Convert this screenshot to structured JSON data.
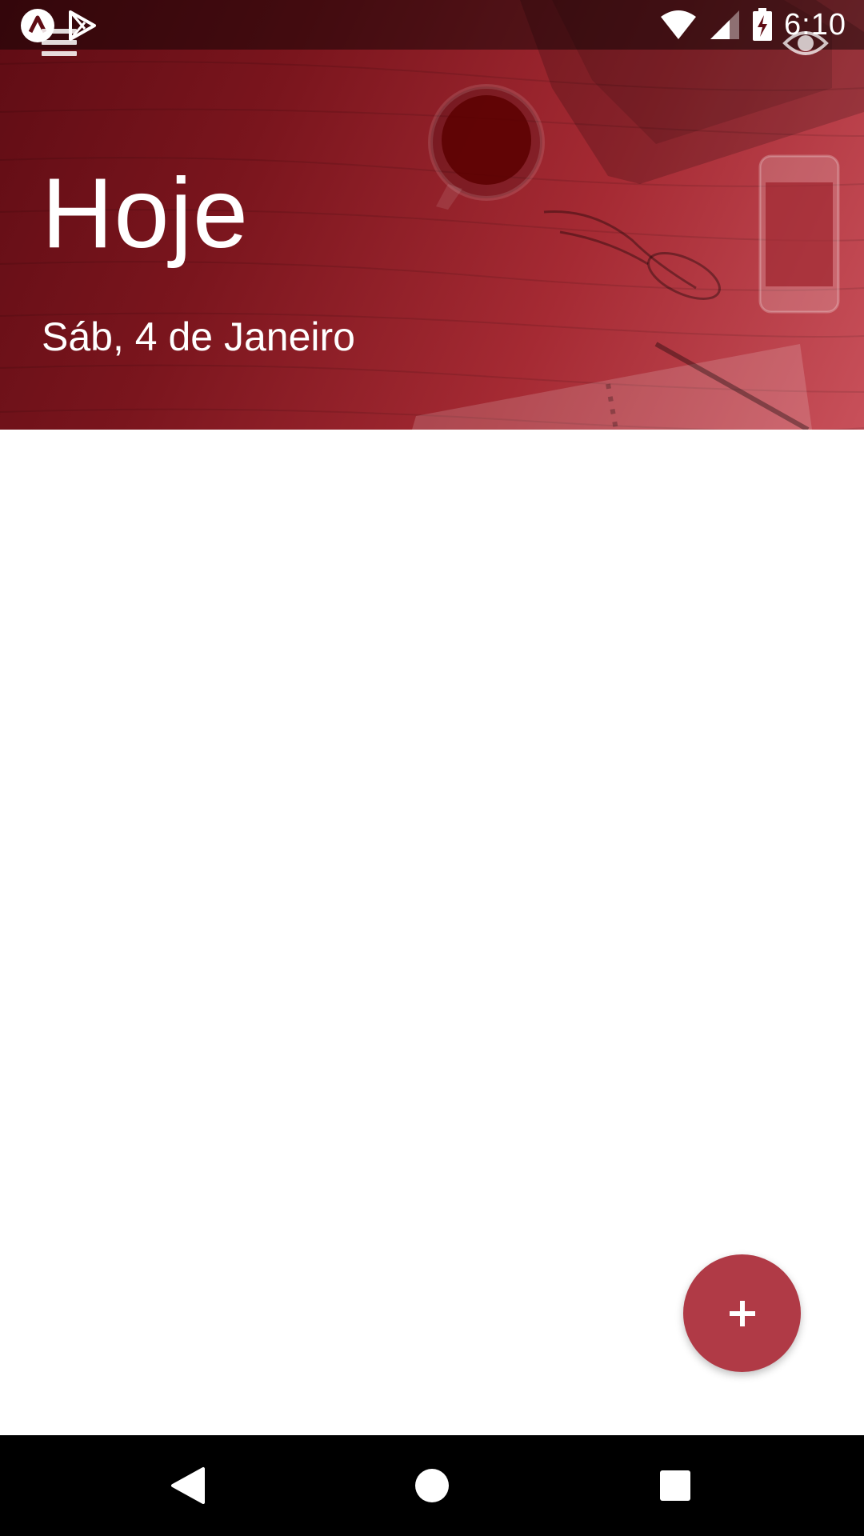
{
  "status_bar": {
    "time": "6:10",
    "left_icons": [
      "app-a-icon",
      "play-store-icon"
    ],
    "right_icons": [
      "wifi-icon",
      "signal-icon",
      "battery-charging-icon"
    ]
  },
  "header": {
    "title": "Hoje",
    "subtitle": "Sáb, 4 de Janeiro",
    "menu_icon": "hamburger-menu-icon",
    "action_icon": "eye-icon",
    "background_colors": {
      "dark": "#5f0c14",
      "mid": "#a52a33",
      "light": "#c8505a"
    }
  },
  "fab": {
    "label": "+",
    "color": "#b03a46"
  },
  "nav_bar": {
    "buttons": [
      "back-icon",
      "home-icon",
      "recents-icon"
    ]
  }
}
